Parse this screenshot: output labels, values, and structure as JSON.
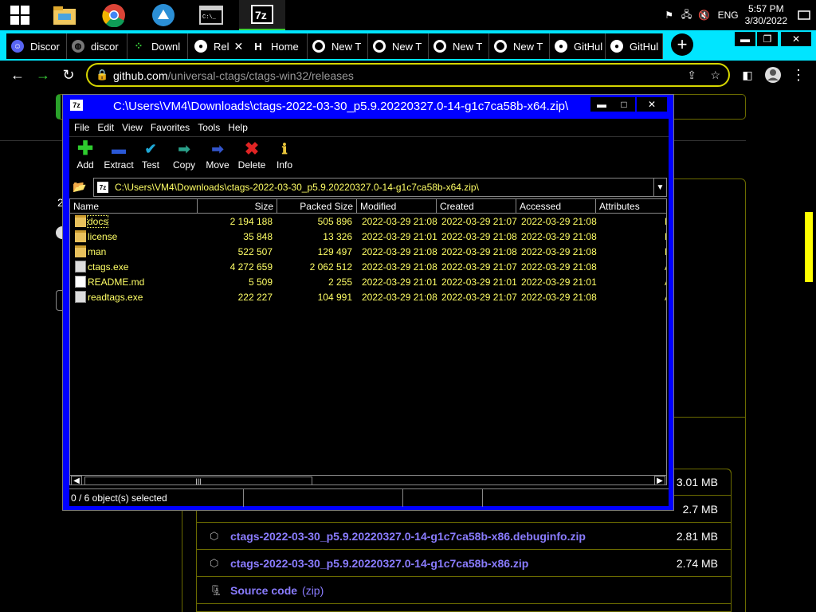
{
  "taskbar": {
    "clock_time": "5:57 PM",
    "clock_date": "3/30/2022",
    "language": "ENG"
  },
  "browser": {
    "tabs": [
      {
        "label": "Discor",
        "icon": "discord-icon"
      },
      {
        "label": "discor",
        "icon": "globe-icon"
      },
      {
        "label": "Downl",
        "icon": "green-dots-icon"
      },
      {
        "label": "Rel",
        "icon": "github-icon",
        "active": true
      },
      {
        "label": "Home",
        "icon": "h-icon"
      },
      {
        "label": "New T",
        "icon": "chrome-icon"
      },
      {
        "label": "New T",
        "icon": "chrome-icon"
      },
      {
        "label": "New T",
        "icon": "chrome-icon"
      },
      {
        "label": "New T",
        "icon": "chrome-icon"
      },
      {
        "label": "GitHul",
        "icon": "github-icon"
      },
      {
        "label": "GitHul",
        "icon": "github-icon"
      }
    ],
    "url_domain": "github.com",
    "url_path": "/universal-ctags/ctags-win32/releases"
  },
  "page": {
    "assets": [
      {
        "name": "",
        "size": "3.01 MB"
      },
      {
        "name": "",
        "size": "2.7 MB"
      },
      {
        "name": "ctags-2022-03-30_p5.9.20220327.0-14-g1c7ca58b-x86.debuginfo.zip",
        "size": "2.81 MB"
      },
      {
        "name": "ctags-2022-03-30_p5.9.20220327.0-14-g1c7ca58b-x86.zip",
        "size": "2.74 MB"
      },
      {
        "name": "Source code",
        "suffix": "(zip)",
        "size": ""
      }
    ]
  },
  "sevenzip": {
    "title": "C:\\Users\\VM4\\Downloads\\ctags-2022-03-30_p5.9.20220327.0-14-g1c7ca58b-x64.zip\\",
    "menu": [
      "File",
      "Edit",
      "View",
      "Favorites",
      "Tools",
      "Help"
    ],
    "toolbar": [
      "Add",
      "Extract",
      "Test",
      "Copy",
      "Move",
      "Delete",
      "Info"
    ],
    "address": "C:\\Users\\VM4\\Downloads\\ctags-2022-03-30_p5.9.20220327.0-14-g1c7ca58b-x64.zip\\",
    "columns": [
      "Name",
      "Size",
      "Packed Size",
      "Modified",
      "Created",
      "Accessed",
      "Attributes"
    ],
    "files": [
      {
        "name": "docs",
        "type": "folder",
        "size": "2 194 188",
        "packed": "505 896",
        "modified": "2022-03-29 21:08",
        "created": "2022-03-29 21:07",
        "accessed": "2022-03-29 21:08",
        "attr": "D"
      },
      {
        "name": "license",
        "type": "folder",
        "size": "35 848",
        "packed": "13 326",
        "modified": "2022-03-29 21:01",
        "created": "2022-03-29 21:08",
        "accessed": "2022-03-29 21:08",
        "attr": "D"
      },
      {
        "name": "man",
        "type": "folder",
        "size": "522 507",
        "packed": "129 497",
        "modified": "2022-03-29 21:08",
        "created": "2022-03-29 21:08",
        "accessed": "2022-03-29 21:08",
        "attr": "D"
      },
      {
        "name": "ctags.exe",
        "type": "exe",
        "size": "4 272 659",
        "packed": "2 062 512",
        "modified": "2022-03-29 21:08",
        "created": "2022-03-29 21:07",
        "accessed": "2022-03-29 21:08",
        "attr": "A"
      },
      {
        "name": "README.md",
        "type": "doc",
        "size": "5 509",
        "packed": "2 255",
        "modified": "2022-03-29 21:01",
        "created": "2022-03-29 21:01",
        "accessed": "2022-03-29 21:01",
        "attr": "A"
      },
      {
        "name": "readtags.exe",
        "type": "exe",
        "size": "222 227",
        "packed": "104 991",
        "modified": "2022-03-29 21:08",
        "created": "2022-03-29 21:07",
        "accessed": "2022-03-29 21:08",
        "attr": "A"
      }
    ],
    "status": "0 / 6 object(s) selected"
  }
}
